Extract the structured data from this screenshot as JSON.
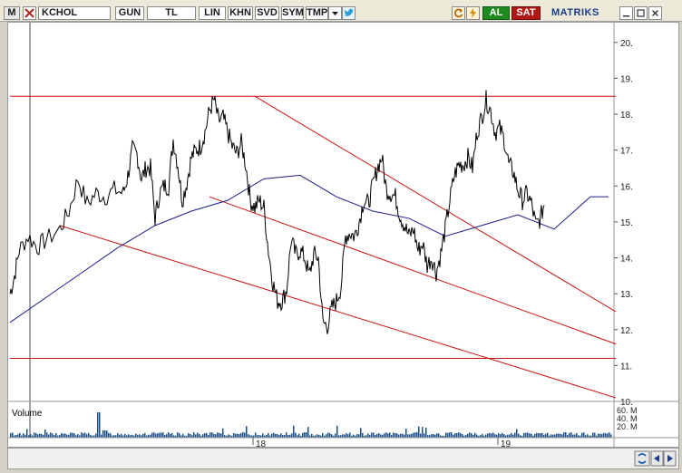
{
  "toolbar": {
    "menu_label": "M",
    "symbol": "KCHOL",
    "period": "GUN",
    "currency": "TL",
    "scale": "LIN",
    "khn": "KHN",
    "svd": "SVD",
    "sym": "SYM",
    "tmp": "TMP",
    "buy_label": "AL",
    "sell_label": "SAT",
    "brand": "MATRIKS",
    "icons": [
      "dropdown-arrow-icon",
      "twitter-icon",
      "refresh-icon",
      "lightning-icon",
      "minimize-icon",
      "maximize-icon",
      "close-icon"
    ]
  },
  "chart_data": {
    "type": "line",
    "title": "",
    "price_axis": {
      "ylim": [
        10,
        20.5
      ],
      "ticks": [
        "10.",
        "11.",
        "12.",
        "13.",
        "14.",
        "15.",
        "16.",
        "17.",
        "18.",
        "19.",
        "20."
      ]
    },
    "volume_panel": {
      "label": "Volume",
      "ticks": [
        "60. M",
        "40. M",
        "20. M"
      ]
    },
    "x_axis": {
      "ticks": [
        "18",
        "19"
      ]
    },
    "colors": {
      "price": "#000000",
      "moving_average": "#1c1c8c",
      "trendline": "#cc1111",
      "volume": "#1a4f8a",
      "gridline": "#dcdcdc"
    },
    "price_series": {
      "name": "",
      "x": [
        0,
        5,
        10,
        20,
        30,
        40,
        55,
        65,
        75,
        85,
        95,
        105,
        115,
        125,
        130,
        135,
        140,
        145,
        150,
        155,
        160,
        165,
        170,
        175,
        180,
        185,
        190,
        195,
        200,
        205,
        210,
        215,
        220,
        225,
        230,
        235,
        240,
        245,
        250,
        255,
        260,
        265,
        270,
        275,
        280,
        285,
        290,
        295,
        300,
        305,
        310,
        315,
        320,
        325,
        330,
        335,
        340,
        345,
        350,
        355,
        360,
        365,
        370,
        375,
        380,
        385,
        390,
        395,
        400,
        405,
        410,
        415,
        420,
        425,
        430,
        435,
        440,
        445,
        450,
        455,
        460,
        465,
        470,
        475,
        480,
        485,
        490,
        495,
        500,
        505,
        510,
        515,
        520,
        525,
        530,
        535,
        540,
        545,
        550,
        555,
        560,
        565,
        570,
        575,
        580,
        585,
        590,
        595,
        600,
        605,
        610,
        615,
        620,
        625,
        630,
        635,
        640,
        645,
        650,
        655,
        660
      ],
      "values": [
        13.0,
        13.5,
        14.2,
        14.6,
        14.3,
        14.5,
        14.8,
        15.3,
        16.2,
        15.5,
        15.8,
        15.7,
        15.9,
        15.8,
        16.3,
        17.0,
        16.9,
        16.2,
        16.5,
        16.5,
        15.1,
        15.8,
        16.0,
        16.0,
        17.3,
        16.6,
        15.6,
        16.1,
        16.8,
        17.0,
        17.1,
        17.5,
        18.1,
        18.4,
        17.8,
        17.9,
        17.5,
        17.1,
        16.9,
        17.2,
        16.6,
        15.6,
        15.4,
        15.6,
        15.4,
        14.2,
        13.3,
        12.8,
        12.8,
        13.1,
        14.5,
        14.1,
        14.2,
        14.0,
        13.5,
        14.1,
        14.0,
        12.2,
        12.1,
        12.6,
        12.8,
        13.2,
        14.6,
        14.7,
        14.6,
        15.0,
        15.6,
        15.5,
        16.0,
        16.5,
        16.8,
        15.9,
        15.8,
        15.7,
        15.2,
        14.9,
        14.6,
        14.8,
        14.2,
        14.4,
        13.8,
        14.0,
        13.6,
        14.1,
        14.8,
        15.6,
        16.3,
        16.6,
        16.6,
        16.8,
        16.5,
        17.5,
        17.9,
        18.4,
        18.1,
        17.5,
        17.6,
        17.3,
        16.6,
        16.4,
        15.9,
        15.6,
        15.8,
        15.5,
        14.9,
        15.1,
        15.6
      ]
    },
    "moving_average": {
      "name": "",
      "x": [
        0,
        40,
        80,
        120,
        160,
        200,
        240,
        280,
        320,
        360,
        400,
        440,
        480,
        520,
        560,
        600,
        640,
        660
      ],
      "values": [
        12.2,
        12.9,
        13.6,
        14.3,
        14.9,
        15.3,
        15.6,
        16.2,
        16.3,
        15.7,
        15.3,
        15.1,
        14.6,
        14.9,
        15.2,
        14.8,
        15.7,
        15.7
      ]
    },
    "trendlines": [
      {
        "x": [
          0,
          668
        ],
        "y": [
          18.5,
          18.5
        ]
      },
      {
        "x": [
          0,
          668
        ],
        "y": [
          11.2,
          11.2
        ]
      },
      {
        "x": [
          270,
          668
        ],
        "y": [
          18.5,
          12.5
        ]
      },
      {
        "x": [
          55,
          668
        ],
        "y": [
          14.9,
          10.1
        ]
      },
      {
        "x": [
          220,
          668
        ],
        "y": [
          15.7,
          11.6
        ]
      }
    ]
  }
}
